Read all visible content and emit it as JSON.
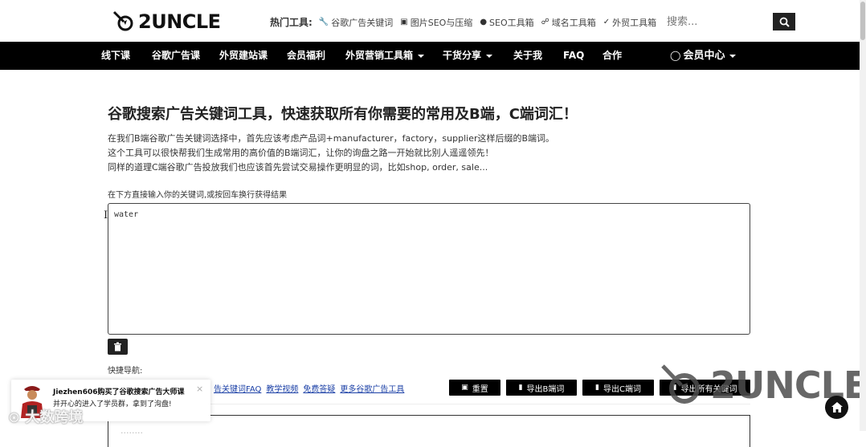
{
  "header": {
    "logo_text": "2UNCLE",
    "hot_label": "热门工具:",
    "hot_tools": [
      {
        "icon": "wrench-icon",
        "label": "谷歌广告关键词"
      },
      {
        "icon": "image-icon",
        "label": "图片SEO与压缩"
      },
      {
        "icon": "seo-icon",
        "label": "SEO工具箱"
      },
      {
        "icon": "domain-icon",
        "label": "域名工具箱"
      },
      {
        "icon": "check-icon",
        "label": "外贸工具箱"
      }
    ],
    "search_placeholder": "搜索..."
  },
  "nav": {
    "items": [
      {
        "label": "线下课",
        "dropdown": false
      },
      {
        "label": "谷歌广告课",
        "dropdown": false
      },
      {
        "label": "外贸建站课",
        "dropdown": false
      },
      {
        "label": "会员福利",
        "dropdown": false
      },
      {
        "label": "外贸营销工具箱",
        "dropdown": true
      },
      {
        "label": "干货分享",
        "dropdown": true
      },
      {
        "label": "关于我",
        "dropdown": false
      },
      {
        "label": "FAQ",
        "dropdown": false
      },
      {
        "label": "合作",
        "dropdown": false
      }
    ],
    "member_label": "会员中心"
  },
  "main": {
    "title": "谷歌搜索广告关键词工具，快速获取所有你需要的常用及B端，C端词汇！",
    "desc_lines": [
      "在我们B端谷歌广告关键词选择中，首先应该考虑产品词+manufacturer，factory，supplier这样后缀的B端词。",
      "这个工具可以很快帮我们生成常用的高价值的B端词汇，让你的询盘之路一开始就比别人遥遥领先！",
      "同样的道理C端谷歌广告投放我们也应该首先尝试交易操作更明显的词，比如shop, order, sale..."
    ],
    "instruction": "在下方直接输入你的关键词,或按回车换行获得结果",
    "keyword_value": "water",
    "quick_nav_label": "快捷导航:",
    "links": [
      "告关键词FAQ",
      "教学视频",
      "免费答疑",
      "更多谷歌广告工具"
    ],
    "buttons": {
      "reset": "重置",
      "export_b": "导出B端词",
      "export_c": "导出C端词",
      "export_all": "导出所有关键词"
    },
    "result_preview": "........"
  },
  "watermark": {
    "text": "2UNCLE"
  },
  "toast": {
    "name": "Jiezhen606购买了谷歌搜索广告大师课",
    "message": "并开心的进入了学员群，拿到了洵盘!",
    "close": "×"
  },
  "overlay_watermark": "大数跨境",
  "colors": {
    "nav_bg": "#000000",
    "link": "#1a3fa6",
    "button_bg": "#000000"
  }
}
